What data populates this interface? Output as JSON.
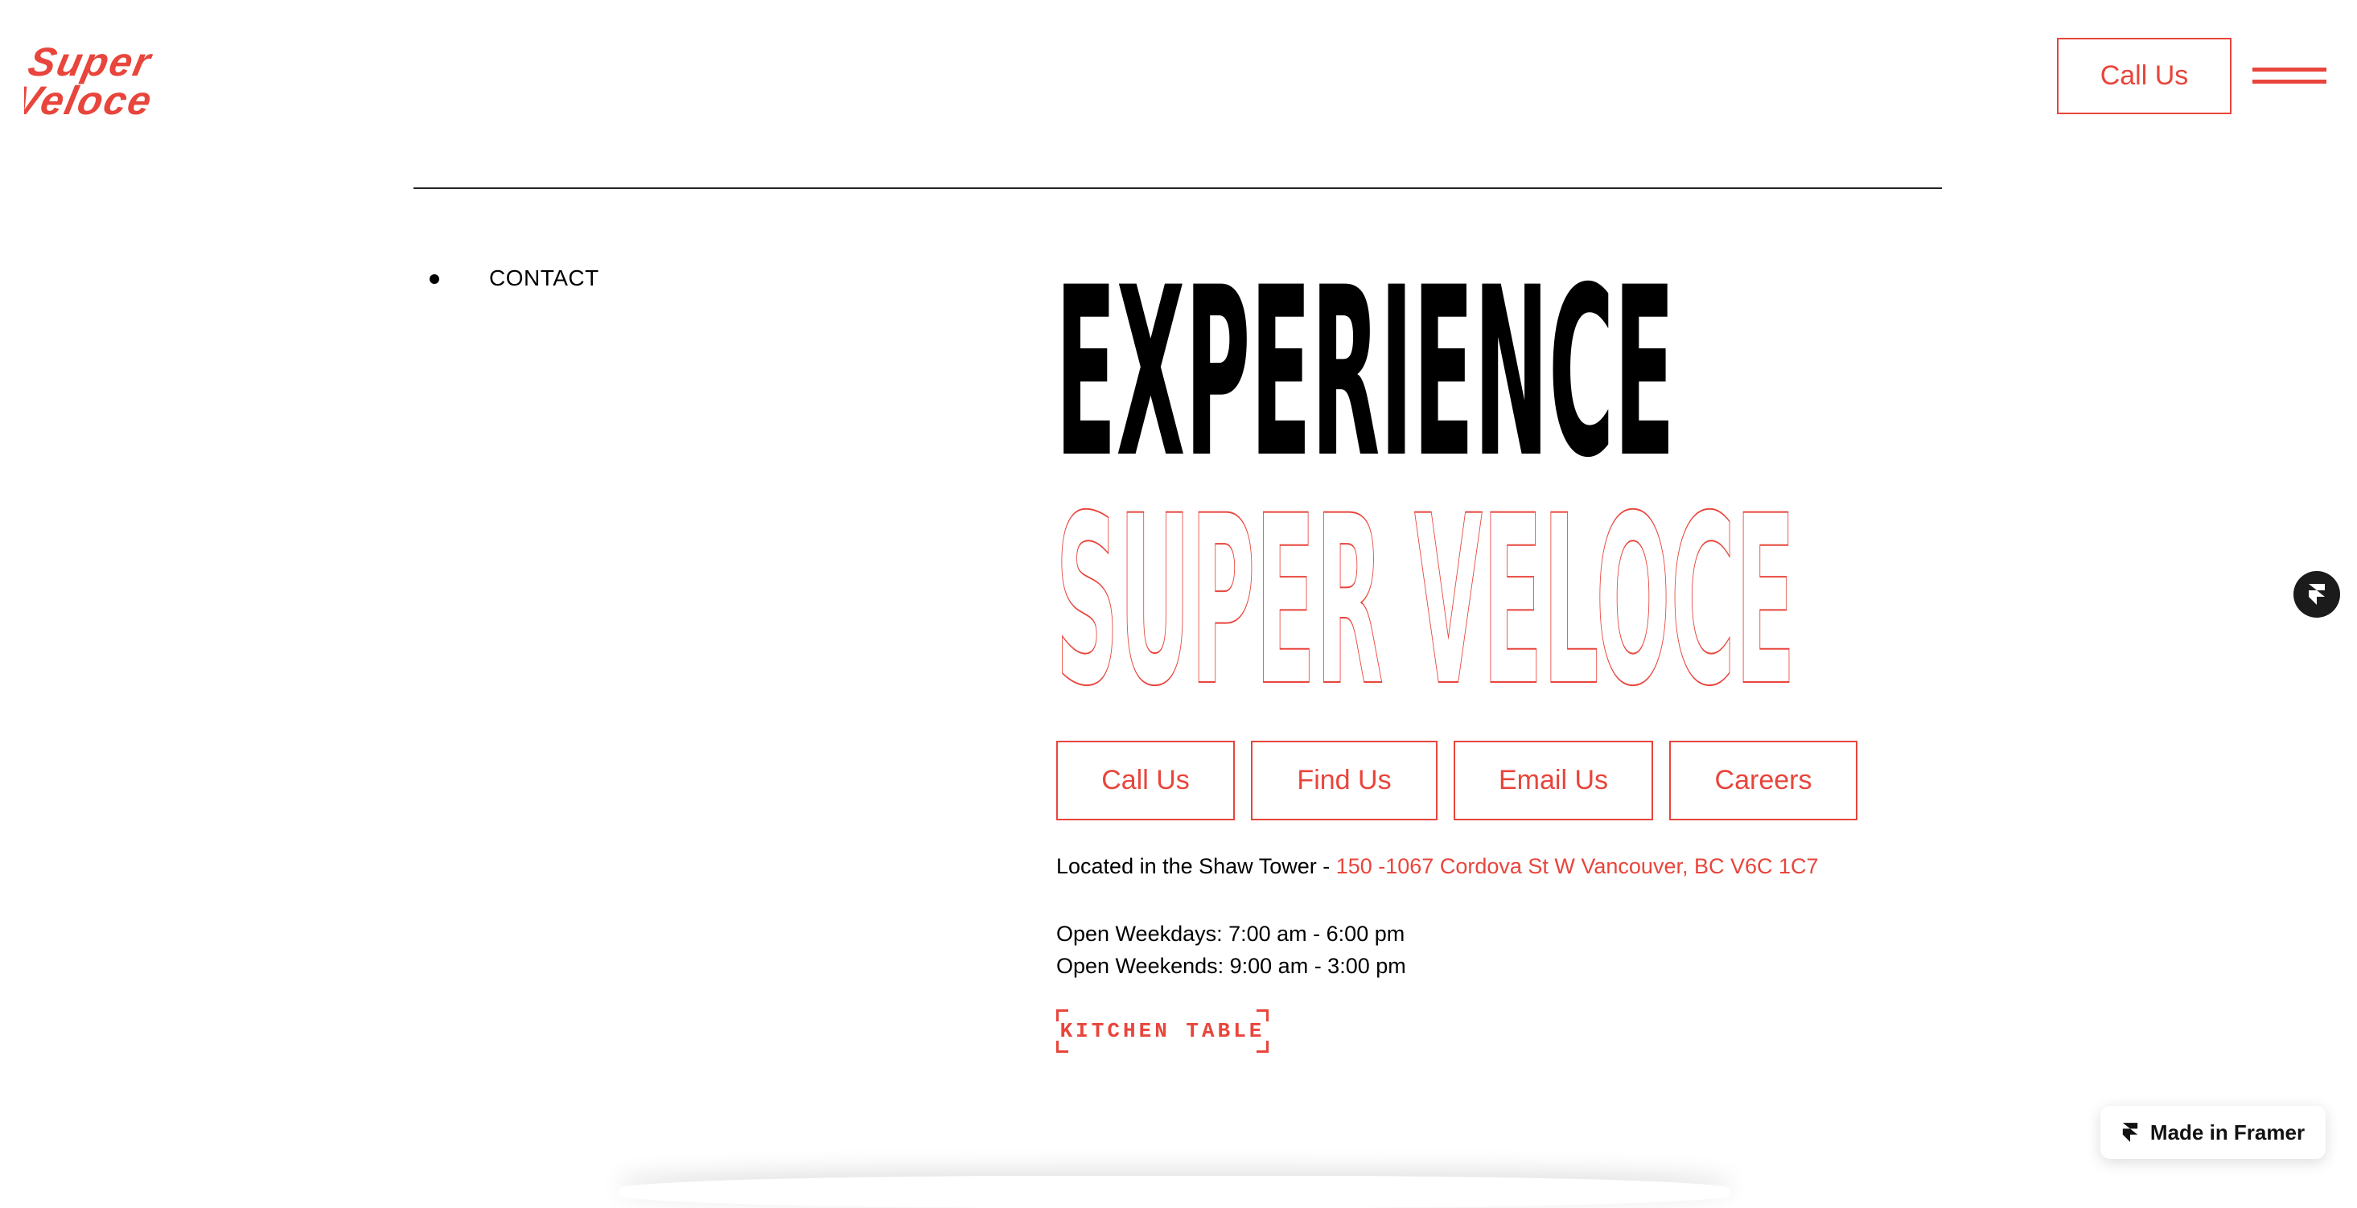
{
  "brand": {
    "logo_line1": "Super",
    "logo_line2": "Veloce",
    "accent_color": "#e8453c"
  },
  "header": {
    "call_label": "Call Us",
    "menu_icon": "hamburger-menu-icon"
  },
  "side_nav": {
    "items": [
      {
        "label": "CONTACT"
      }
    ]
  },
  "hero": {
    "line1": "EXPERIENCE",
    "line2": "SUPER VELOCE"
  },
  "actions": [
    {
      "label": "Call Us"
    },
    {
      "label": "Find Us"
    },
    {
      "label": "Email Us"
    },
    {
      "label": "Careers"
    }
  ],
  "location": {
    "prefix": "Located in the Shaw Tower - ",
    "address": "150 -1067 Cordova St W Vancouver, BC  V6C 1C7"
  },
  "hours": {
    "weekdays": "Open Weekdays:  7:00 am - 6:00 pm",
    "weekends": "Open Weekends:  9:00 am - 3:00 pm"
  },
  "partner": {
    "label": "KITCHEN TABLE"
  },
  "framer": {
    "badge_label": "Made in Framer",
    "icon": "framer-icon"
  }
}
